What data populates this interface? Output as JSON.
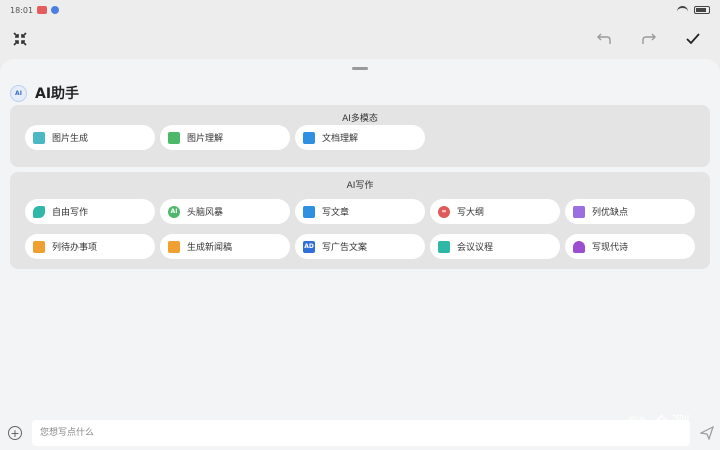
{
  "status_bar": {
    "time": "18:01"
  },
  "sheet": {
    "title": "AI助手"
  },
  "sections": [
    {
      "title": "AI多模态",
      "items": [
        {
          "label": "图片生成",
          "icon": "image-generate-icon",
          "color": "#4bb8c4"
        },
        {
          "label": "图片理解",
          "icon": "image-understand-icon",
          "color": "#4db86a"
        },
        {
          "label": "文档理解",
          "icon": "document-understand-icon",
          "color": "#2f8fe0"
        }
      ]
    },
    {
      "title": "AI写作",
      "items": [
        {
          "label": "自由写作",
          "icon": "feather-icon",
          "color": "#2fb8a8"
        },
        {
          "label": "头脑风暴",
          "icon": "brainstorm-icon",
          "color": "#4db86a"
        },
        {
          "label": "写文章",
          "icon": "article-icon",
          "color": "#2f8fe0"
        },
        {
          "label": "写大纲",
          "icon": "outline-icon",
          "color": "#e05a5a"
        },
        {
          "label": "列优缺点",
          "icon": "pros-cons-icon",
          "color": "#9b6fe0"
        },
        {
          "label": "列待办事项",
          "icon": "todo-icon",
          "color": "#f0a030"
        },
        {
          "label": "生成新闻稿",
          "icon": "news-icon",
          "color": "#f0a030"
        },
        {
          "label": "写广告文案",
          "icon": "ad-icon",
          "color": "#2f6fd8"
        },
        {
          "label": "会议议程",
          "icon": "meeting-icon",
          "color": "#2fb8a8"
        },
        {
          "label": "写现代诗",
          "icon": "poem-icon",
          "color": "#9b4fd0"
        }
      ]
    }
  ],
  "input": {
    "placeholder": "您想写点什么"
  },
  "watermark": {
    "small": "新浪",
    "big": "众测"
  }
}
